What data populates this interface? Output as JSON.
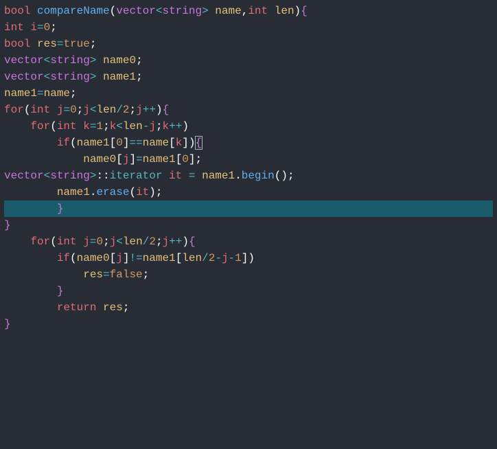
{
  "code": {
    "lines": [
      {
        "tokens": [
          {
            "t": "bool",
            "c": "kw-bool"
          },
          {
            "t": " ",
            "c": "punct"
          },
          {
            "t": "compareName",
            "c": "fn-name"
          },
          {
            "t": "(",
            "c": "white"
          },
          {
            "t": "vector",
            "c": "str-type"
          },
          {
            "t": "<",
            "c": "op"
          },
          {
            "t": "string",
            "c": "str-type"
          },
          {
            "t": ">",
            "c": "op"
          },
          {
            "t": " ",
            "c": "punct"
          },
          {
            "t": "name",
            "c": "ident"
          },
          {
            "t": ",",
            "c": "white"
          },
          {
            "t": "int",
            "c": "kw-type"
          },
          {
            "t": " ",
            "c": "punct"
          },
          {
            "t": "len",
            "c": "ident"
          },
          {
            "t": ")",
            "c": "white"
          },
          {
            "t": "{",
            "c": "brace"
          }
        ]
      },
      {
        "tokens": [
          {
            "t": "int",
            "c": "kw-type"
          },
          {
            "t": " ",
            "c": "punct"
          },
          {
            "t": "i",
            "c": "ident2"
          },
          {
            "t": "=",
            "c": "op"
          },
          {
            "t": "0",
            "c": "num"
          },
          {
            "t": ";",
            "c": "white"
          }
        ]
      },
      {
        "tokens": [
          {
            "t": "bool",
            "c": "kw-bool"
          },
          {
            "t": " ",
            "c": "punct"
          },
          {
            "t": "res",
            "c": "ident"
          },
          {
            "t": "=",
            "c": "op"
          },
          {
            "t": "true",
            "c": "bool-lit"
          },
          {
            "t": ";",
            "c": "white"
          }
        ]
      },
      {
        "tokens": [
          {
            "t": "vector",
            "c": "str-type"
          },
          {
            "t": "<",
            "c": "op"
          },
          {
            "t": "string",
            "c": "str-type"
          },
          {
            "t": ">",
            "c": "op"
          },
          {
            "t": " ",
            "c": "punct"
          },
          {
            "t": "name0",
            "c": "ident"
          },
          {
            "t": ";",
            "c": "white"
          }
        ]
      },
      {
        "tokens": [
          {
            "t": "vector",
            "c": "str-type"
          },
          {
            "t": "<",
            "c": "op"
          },
          {
            "t": "string",
            "c": "str-type"
          },
          {
            "t": ">",
            "c": "op"
          },
          {
            "t": " ",
            "c": "punct"
          },
          {
            "t": "name1",
            "c": "ident"
          },
          {
            "t": ";",
            "c": "white"
          }
        ]
      },
      {
        "tokens": [
          {
            "t": "name1",
            "c": "ident"
          },
          {
            "t": "=",
            "c": "op"
          },
          {
            "t": "name",
            "c": "ident"
          },
          {
            "t": ";",
            "c": "white"
          }
        ]
      },
      {
        "tokens": [
          {
            "t": "for",
            "c": "kw-type"
          },
          {
            "t": "(",
            "c": "white"
          },
          {
            "t": "int",
            "c": "kw-type"
          },
          {
            "t": " ",
            "c": "punct"
          },
          {
            "t": "j",
            "c": "ident2"
          },
          {
            "t": "=",
            "c": "op"
          },
          {
            "t": "0",
            "c": "num"
          },
          {
            "t": ";",
            "c": "white"
          },
          {
            "t": "j",
            "c": "ident2"
          },
          {
            "t": "<",
            "c": "op"
          },
          {
            "t": "len",
            "c": "ident"
          },
          {
            "t": "/",
            "c": "op"
          },
          {
            "t": "2",
            "c": "num"
          },
          {
            "t": ";",
            "c": "white"
          },
          {
            "t": "j",
            "c": "ident2"
          },
          {
            "t": "++",
            "c": "op"
          },
          {
            "t": ")",
            "c": "white"
          },
          {
            "t": "{",
            "c": "brace"
          }
        ]
      },
      {
        "tokens": [
          {
            "t": "    ",
            "c": "punct"
          },
          {
            "t": "for",
            "c": "kw-type"
          },
          {
            "t": "(",
            "c": "white"
          },
          {
            "t": "int",
            "c": "kw-type"
          },
          {
            "t": " ",
            "c": "punct"
          },
          {
            "t": "k",
            "c": "ident2"
          },
          {
            "t": "=",
            "c": "op"
          },
          {
            "t": "1",
            "c": "num"
          },
          {
            "t": ";",
            "c": "white"
          },
          {
            "t": "k",
            "c": "ident2"
          },
          {
            "t": "<",
            "c": "op"
          },
          {
            "t": "len",
            "c": "ident"
          },
          {
            "t": "-",
            "c": "op"
          },
          {
            "t": "j",
            "c": "ident2"
          },
          {
            "t": ";",
            "c": "white"
          },
          {
            "t": "k",
            "c": "ident2"
          },
          {
            "t": "++",
            "c": "op"
          },
          {
            "t": ")",
            "c": "white"
          }
        ]
      },
      {
        "tokens": [
          {
            "t": "        ",
            "c": "punct"
          },
          {
            "t": "if",
            "c": "kw-type"
          },
          {
            "t": "(",
            "c": "white"
          },
          {
            "t": "name1",
            "c": "ident"
          },
          {
            "t": "[",
            "c": "white"
          },
          {
            "t": "0",
            "c": "num"
          },
          {
            "t": "]",
            "c": "white"
          },
          {
            "t": "==",
            "c": "op"
          },
          {
            "t": "name",
            "c": "ident"
          },
          {
            "t": "[",
            "c": "white"
          },
          {
            "t": "k",
            "c": "ident2"
          },
          {
            "t": "]",
            "c": "white"
          },
          {
            "t": ")",
            "c": "white"
          },
          {
            "t": "{",
            "c": "brace",
            "cursor": true
          }
        ]
      },
      {
        "tokens": [
          {
            "t": "            ",
            "c": "punct"
          },
          {
            "t": "name0",
            "c": "ident"
          },
          {
            "t": "[",
            "c": "white"
          },
          {
            "t": "j",
            "c": "ident2"
          },
          {
            "t": "]",
            "c": "white"
          },
          {
            "t": "=",
            "c": "op"
          },
          {
            "t": "name1",
            "c": "ident"
          },
          {
            "t": "[",
            "c": "white"
          },
          {
            "t": "0",
            "c": "num"
          },
          {
            "t": "]",
            "c": "white"
          },
          {
            "t": ";",
            "c": "white"
          }
        ]
      },
      {
        "tokens": [
          {
            "t": "vector",
            "c": "str-type"
          },
          {
            "t": "<",
            "c": "op"
          },
          {
            "t": "string",
            "c": "str-type"
          },
          {
            "t": ">",
            "c": "op"
          },
          {
            "t": "::",
            "c": "white"
          },
          {
            "t": "iterator",
            "c": "it-kw"
          },
          {
            "t": " ",
            "c": "punct"
          },
          {
            "t": "it",
            "c": "ident2"
          },
          {
            "t": " ",
            "c": "punct"
          },
          {
            "t": "=",
            "c": "op"
          },
          {
            "t": " ",
            "c": "punct"
          },
          {
            "t": "name1",
            "c": "ident"
          },
          {
            "t": ".",
            "c": "white"
          },
          {
            "t": "begin",
            "c": "fn-name"
          },
          {
            "t": "()",
            "c": "white"
          },
          {
            "t": ";",
            "c": "white"
          }
        ]
      },
      {
        "tokens": [
          {
            "t": "        ",
            "c": "punct"
          },
          {
            "t": "name1",
            "c": "ident"
          },
          {
            "t": ".",
            "c": "white"
          },
          {
            "t": "erase",
            "c": "fn-name"
          },
          {
            "t": "(",
            "c": "white"
          },
          {
            "t": "it",
            "c": "ident2"
          },
          {
            "t": ")",
            "c": "white"
          },
          {
            "t": ";",
            "c": "white"
          }
        ]
      },
      {
        "highlight": true,
        "tokens": [
          {
            "t": "        ",
            "c": "punct"
          },
          {
            "t": "}",
            "c": "brace"
          }
        ]
      },
      {
        "tokens": [
          {
            "t": "}",
            "c": "brace"
          }
        ]
      },
      {
        "tokens": [
          {
            "t": "    ",
            "c": "punct"
          },
          {
            "t": "for",
            "c": "kw-type"
          },
          {
            "t": "(",
            "c": "white"
          },
          {
            "t": "int",
            "c": "kw-type"
          },
          {
            "t": " ",
            "c": "punct"
          },
          {
            "t": "j",
            "c": "ident2"
          },
          {
            "t": "=",
            "c": "op"
          },
          {
            "t": "0",
            "c": "num"
          },
          {
            "t": ";",
            "c": "white"
          },
          {
            "t": "j",
            "c": "ident2"
          },
          {
            "t": "<",
            "c": "op"
          },
          {
            "t": "len",
            "c": "ident"
          },
          {
            "t": "/",
            "c": "op"
          },
          {
            "t": "2",
            "c": "num"
          },
          {
            "t": ";",
            "c": "white"
          },
          {
            "t": "j",
            "c": "ident2"
          },
          {
            "t": "++",
            "c": "op"
          },
          {
            "t": ")",
            "c": "white"
          },
          {
            "t": "{",
            "c": "brace"
          }
        ]
      },
      {
        "tokens": [
          {
            "t": "        ",
            "c": "punct"
          },
          {
            "t": "if",
            "c": "kw-type"
          },
          {
            "t": "(",
            "c": "white"
          },
          {
            "t": "name0",
            "c": "ident"
          },
          {
            "t": "[",
            "c": "white"
          },
          {
            "t": "j",
            "c": "ident2"
          },
          {
            "t": "]",
            "c": "white"
          },
          {
            "t": "!=",
            "c": "op"
          },
          {
            "t": "name1",
            "c": "ident"
          },
          {
            "t": "[",
            "c": "white"
          },
          {
            "t": "len",
            "c": "ident"
          },
          {
            "t": "/",
            "c": "op"
          },
          {
            "t": "2",
            "c": "num"
          },
          {
            "t": "-",
            "c": "op"
          },
          {
            "t": "j",
            "c": "ident2"
          },
          {
            "t": "-",
            "c": "op"
          },
          {
            "t": "1",
            "c": "num"
          },
          {
            "t": "]",
            "c": "white"
          },
          {
            "t": ")",
            "c": "white"
          }
        ]
      },
      {
        "tokens": [
          {
            "t": "            ",
            "c": "punct"
          },
          {
            "t": "res",
            "c": "ident"
          },
          {
            "t": "=",
            "c": "op"
          },
          {
            "t": "false",
            "c": "bool-lit"
          },
          {
            "t": ";",
            "c": "white"
          }
        ]
      },
      {
        "tokens": [
          {
            "t": "        ",
            "c": "punct"
          },
          {
            "t": "}",
            "c": "brace"
          }
        ]
      },
      {
        "tokens": [
          {
            "t": "        ",
            "c": "punct"
          },
          {
            "t": "return",
            "c": "kw-type"
          },
          {
            "t": " ",
            "c": "punct"
          },
          {
            "t": "res",
            "c": "ident"
          },
          {
            "t": ";",
            "c": "white"
          }
        ]
      },
      {
        "tokens": [
          {
            "t": "}",
            "c": "brace"
          }
        ]
      }
    ]
  }
}
